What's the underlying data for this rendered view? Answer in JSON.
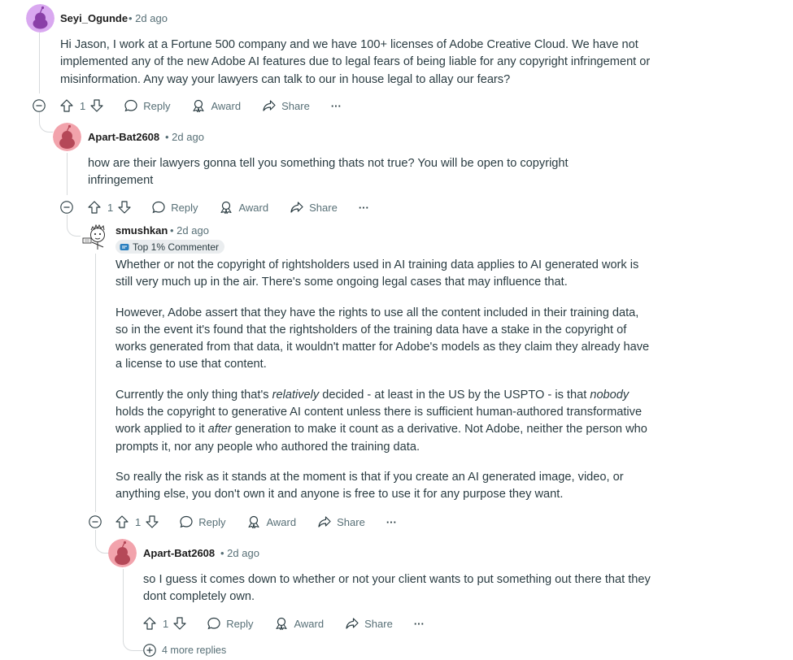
{
  "comments": [
    {
      "username": "Seyi_Ogunde",
      "time": "• 2d ago",
      "paragraphs": [
        "Hi Jason, I work at a Fortune 500 company and we have 100+ licenses of Adobe Creative Cloud. We have not implemented any of the new Adobe AI features due to legal fears of being liable for any copyright infringement or misinformation. Any way your lawyers can talk to our in house legal to allay our fears?"
      ],
      "votes": "1",
      "avatar_color": "#d9a8f0"
    },
    {
      "username": "Apart-Bat2608",
      "time": "• 2d ago",
      "paragraphs": [
        "how are their lawyers gonna tell you something thats not true? You will be open to copyright infringement"
      ],
      "votes": "1",
      "avatar_color": "#f2a3ac"
    },
    {
      "username": "smushkan",
      "time": "• 2d ago",
      "badge": "Top 1% Commenter",
      "p1": "Whether or not the copyright of rightsholders used in AI training data applies to AI generated work is still very much up in the air. There's some ongoing legal cases that may influence that.",
      "p2": "However, Adobe assert that they have the rights to use all the content included in their training data, so in the event it's found that the rightsholders of the training data have a stake in the copyright of works generated from that data, it wouldn't matter for Adobe's models as they claim they already have a license to use that content.",
      "p3": {
        "a": "Currently the only thing that's ",
        "b": "relatively",
        "c": " decided - at least in the US by the USPTO - is that ",
        "d": "nobody",
        "e": " holds the copyright to generative AI content unless there is sufficient human-authored transformative work applied to it ",
        "f": "after",
        "g": " generation to make it count as a derivative. Not Adobe, neither the person who prompts it, nor any people who authored the training data."
      },
      "p4": "So really the risk as it stands at the moment is that if you create an AI generated image, video, or anything else, you don't own it and anyone is free to use it for any purpose they want.",
      "votes": "1"
    },
    {
      "username": "Apart-Bat2608",
      "time": "• 2d ago",
      "paragraphs": [
        "so I guess it comes down to whether or not your client wants to put something out there that they dont completely own."
      ],
      "votes": "1",
      "avatar_color": "#f2a3ac"
    }
  ],
  "actions": {
    "reply": "Reply",
    "award": "Award",
    "share": "Share",
    "more": "···"
  },
  "more_replies": "4 more replies"
}
